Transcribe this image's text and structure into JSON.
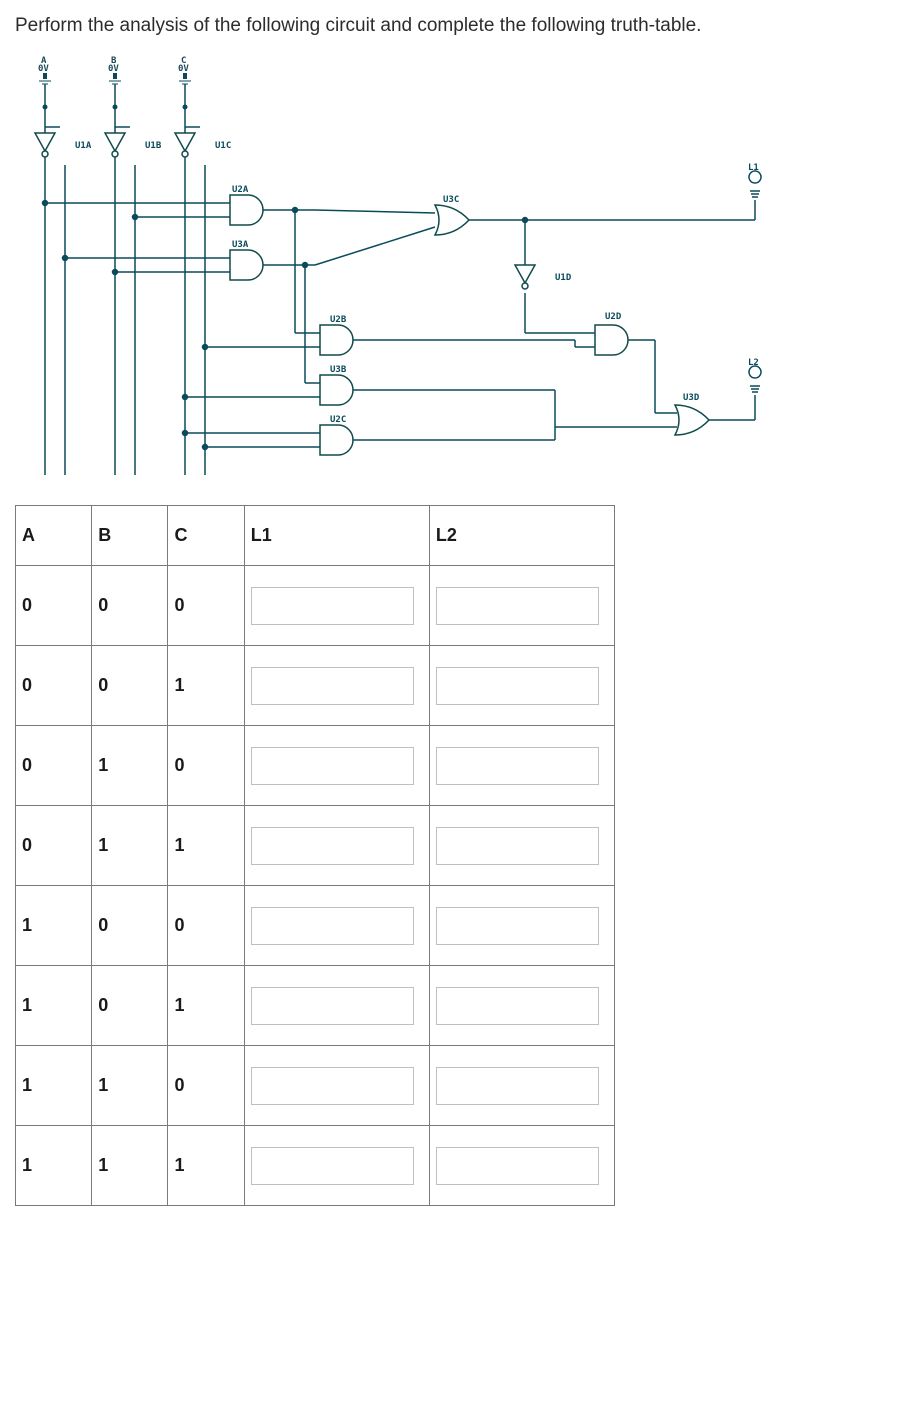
{
  "prompt": "Perform the analysis of the following circuit and complete the following truth-table.",
  "circuit": {
    "sources": [
      {
        "name": "A",
        "sub": "0V"
      },
      {
        "name": "B",
        "sub": "0V"
      },
      {
        "name": "C",
        "sub": "0V"
      }
    ],
    "gates": {
      "u1a": "U1A",
      "u1b": "U1B",
      "u1c": "U1C",
      "u2a": "U2A",
      "u3a": "U3A",
      "u2b": "U2B",
      "u3b": "U3B",
      "u2c": "U2C",
      "u3c": "U3C",
      "u1d": "U1D",
      "u2d": "U2D",
      "u3d": "U3D"
    },
    "outputs": {
      "l1": "L1",
      "l2": "L2"
    }
  },
  "table": {
    "headers": [
      "A",
      "B",
      "C",
      "L1",
      "L2"
    ],
    "rows": [
      {
        "a": "0",
        "b": "0",
        "c": "0"
      },
      {
        "a": "0",
        "b": "0",
        "c": "1"
      },
      {
        "a": "0",
        "b": "1",
        "c": "0"
      },
      {
        "a": "0",
        "b": "1",
        "c": "1"
      },
      {
        "a": "1",
        "b": "0",
        "c": "0"
      },
      {
        "a": "1",
        "b": "0",
        "c": "1"
      },
      {
        "a": "1",
        "b": "1",
        "c": "0"
      },
      {
        "a": "1",
        "b": "1",
        "c": "1"
      }
    ]
  }
}
